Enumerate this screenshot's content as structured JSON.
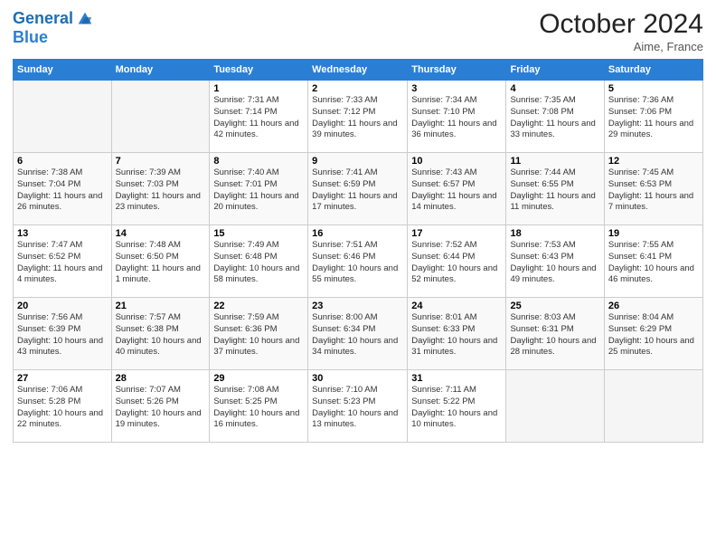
{
  "header": {
    "logo_line1": "General",
    "logo_line2": "Blue",
    "month": "October 2024",
    "location": "Aime, France"
  },
  "weekdays": [
    "Sunday",
    "Monday",
    "Tuesday",
    "Wednesday",
    "Thursday",
    "Friday",
    "Saturday"
  ],
  "weeks": [
    [
      {
        "day": null
      },
      {
        "day": null
      },
      {
        "day": "1",
        "sunrise": "7:31 AM",
        "sunset": "7:14 PM",
        "daylight": "11 hours and 42 minutes."
      },
      {
        "day": "2",
        "sunrise": "7:33 AM",
        "sunset": "7:12 PM",
        "daylight": "11 hours and 39 minutes."
      },
      {
        "day": "3",
        "sunrise": "7:34 AM",
        "sunset": "7:10 PM",
        "daylight": "11 hours and 36 minutes."
      },
      {
        "day": "4",
        "sunrise": "7:35 AM",
        "sunset": "7:08 PM",
        "daylight": "11 hours and 33 minutes."
      },
      {
        "day": "5",
        "sunrise": "7:36 AM",
        "sunset": "7:06 PM",
        "daylight": "11 hours and 29 minutes."
      }
    ],
    [
      {
        "day": "6",
        "sunrise": "7:38 AM",
        "sunset": "7:04 PM",
        "daylight": "11 hours and 26 minutes."
      },
      {
        "day": "7",
        "sunrise": "7:39 AM",
        "sunset": "7:03 PM",
        "daylight": "11 hours and 23 minutes."
      },
      {
        "day": "8",
        "sunrise": "7:40 AM",
        "sunset": "7:01 PM",
        "daylight": "11 hours and 20 minutes."
      },
      {
        "day": "9",
        "sunrise": "7:41 AM",
        "sunset": "6:59 PM",
        "daylight": "11 hours and 17 minutes."
      },
      {
        "day": "10",
        "sunrise": "7:43 AM",
        "sunset": "6:57 PM",
        "daylight": "11 hours and 14 minutes."
      },
      {
        "day": "11",
        "sunrise": "7:44 AM",
        "sunset": "6:55 PM",
        "daylight": "11 hours and 11 minutes."
      },
      {
        "day": "12",
        "sunrise": "7:45 AM",
        "sunset": "6:53 PM",
        "daylight": "11 hours and 7 minutes."
      }
    ],
    [
      {
        "day": "13",
        "sunrise": "7:47 AM",
        "sunset": "6:52 PM",
        "daylight": "11 hours and 4 minutes."
      },
      {
        "day": "14",
        "sunrise": "7:48 AM",
        "sunset": "6:50 PM",
        "daylight": "11 hours and 1 minute."
      },
      {
        "day": "15",
        "sunrise": "7:49 AM",
        "sunset": "6:48 PM",
        "daylight": "10 hours and 58 minutes."
      },
      {
        "day": "16",
        "sunrise": "7:51 AM",
        "sunset": "6:46 PM",
        "daylight": "10 hours and 55 minutes."
      },
      {
        "day": "17",
        "sunrise": "7:52 AM",
        "sunset": "6:44 PM",
        "daylight": "10 hours and 52 minutes."
      },
      {
        "day": "18",
        "sunrise": "7:53 AM",
        "sunset": "6:43 PM",
        "daylight": "10 hours and 49 minutes."
      },
      {
        "day": "19",
        "sunrise": "7:55 AM",
        "sunset": "6:41 PM",
        "daylight": "10 hours and 46 minutes."
      }
    ],
    [
      {
        "day": "20",
        "sunrise": "7:56 AM",
        "sunset": "6:39 PM",
        "daylight": "10 hours and 43 minutes."
      },
      {
        "day": "21",
        "sunrise": "7:57 AM",
        "sunset": "6:38 PM",
        "daylight": "10 hours and 40 minutes."
      },
      {
        "day": "22",
        "sunrise": "7:59 AM",
        "sunset": "6:36 PM",
        "daylight": "10 hours and 37 minutes."
      },
      {
        "day": "23",
        "sunrise": "8:00 AM",
        "sunset": "6:34 PM",
        "daylight": "10 hours and 34 minutes."
      },
      {
        "day": "24",
        "sunrise": "8:01 AM",
        "sunset": "6:33 PM",
        "daylight": "10 hours and 31 minutes."
      },
      {
        "day": "25",
        "sunrise": "8:03 AM",
        "sunset": "6:31 PM",
        "daylight": "10 hours and 28 minutes."
      },
      {
        "day": "26",
        "sunrise": "8:04 AM",
        "sunset": "6:29 PM",
        "daylight": "10 hours and 25 minutes."
      }
    ],
    [
      {
        "day": "27",
        "sunrise": "7:06 AM",
        "sunset": "5:28 PM",
        "daylight": "10 hours and 22 minutes."
      },
      {
        "day": "28",
        "sunrise": "7:07 AM",
        "sunset": "5:26 PM",
        "daylight": "10 hours and 19 minutes."
      },
      {
        "day": "29",
        "sunrise": "7:08 AM",
        "sunset": "5:25 PM",
        "daylight": "10 hours and 16 minutes."
      },
      {
        "day": "30",
        "sunrise": "7:10 AM",
        "sunset": "5:23 PM",
        "daylight": "10 hours and 13 minutes."
      },
      {
        "day": "31",
        "sunrise": "7:11 AM",
        "sunset": "5:22 PM",
        "daylight": "10 hours and 10 minutes."
      },
      {
        "day": null
      },
      {
        "day": null
      }
    ]
  ],
  "labels": {
    "sunrise": "Sunrise:",
    "sunset": "Sunset:",
    "daylight": "Daylight:"
  }
}
